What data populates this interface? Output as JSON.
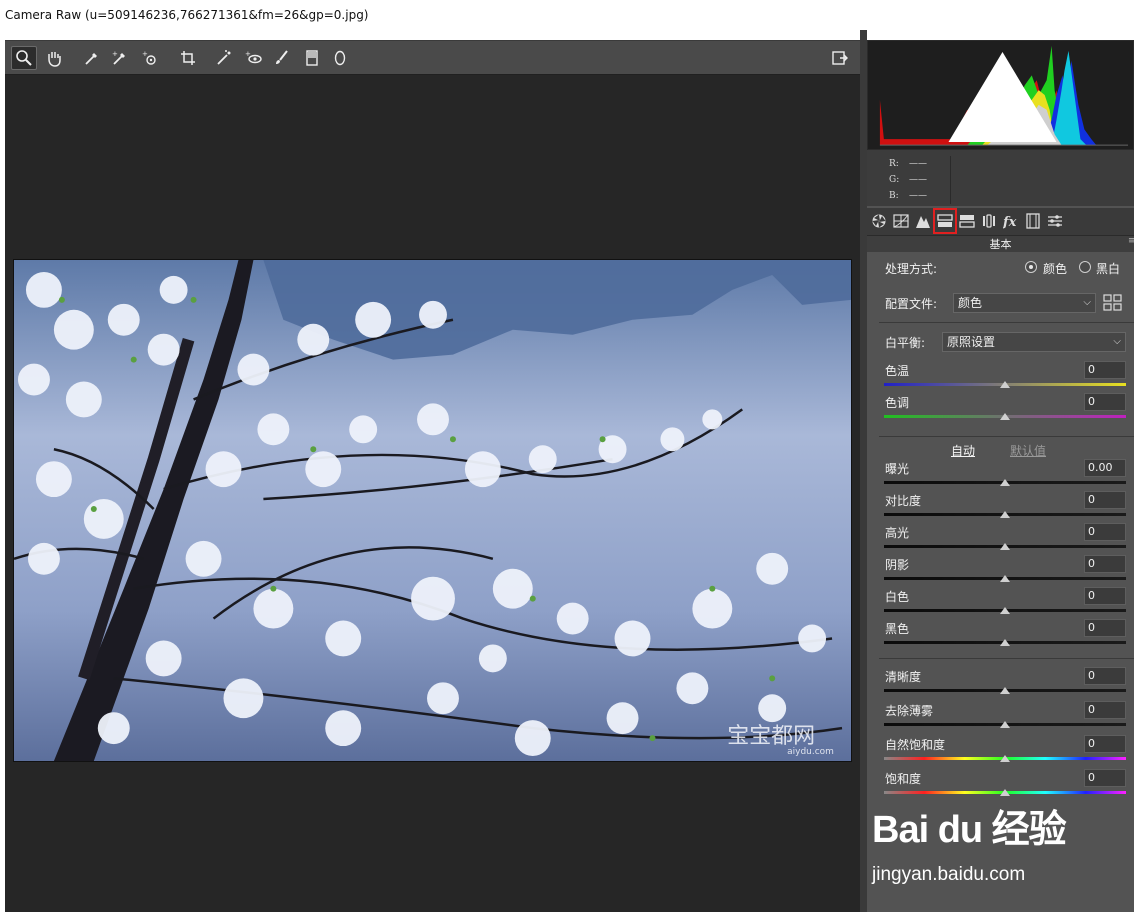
{
  "window": {
    "title": "Camera Raw (u=509146236,766271361&fm=26&gp=0.jpg)"
  },
  "toolbar": {
    "tools": [
      {
        "name": "zoom-icon",
        "active": true
      },
      {
        "name": "hand-icon"
      },
      {
        "name": "white-balance-icon"
      },
      {
        "name": "color-sampler-icon"
      },
      {
        "name": "targeted-adjustment-icon"
      },
      {
        "name": "crop-icon"
      },
      {
        "name": "straighten-icon"
      },
      {
        "name": "red-eye-icon"
      },
      {
        "name": "brush-icon"
      },
      {
        "name": "graduated-filter-icon"
      },
      {
        "name": "radial-filter-icon"
      }
    ],
    "fullscreen": "fullscreen-icon"
  },
  "histogram": {
    "rgb": {
      "r_label": "R:",
      "g_label": "G:",
      "b_label": "B:",
      "r": "——",
      "g": "——",
      "b": "——"
    }
  },
  "panel_tabs": [
    {
      "name": "basic-tab-icon"
    },
    {
      "name": "tone-curve-tab-icon"
    },
    {
      "name": "detail-tab-icon"
    },
    {
      "name": "hsl-tab-icon",
      "highlighted": true
    },
    {
      "name": "split-toning-tab-icon"
    },
    {
      "name": "lens-corrections-tab-icon"
    },
    {
      "name": "effects-tab-icon"
    },
    {
      "name": "camera-calibration-tab-icon"
    },
    {
      "name": "presets-tab-icon"
    }
  ],
  "basic": {
    "section_title": "基本",
    "treatment_label": "处理方式:",
    "treatment_color": "颜色",
    "treatment_bw": "黑白",
    "treatment_selected": "color",
    "profile_label": "配置文件:",
    "profile_value": "颜色",
    "wb_label": "白平衡:",
    "wb_value": "原照设置",
    "auto_label": "自动",
    "default_label": "默认值",
    "sliders": [
      {
        "label": "色温",
        "value": "0",
        "position": 0.5,
        "track": "temp"
      },
      {
        "label": "色调",
        "value": "0",
        "position": 0.5,
        "track": "tint"
      },
      {
        "label": "曝光",
        "value": "0.00",
        "position": 0.5,
        "track": "dark"
      },
      {
        "label": "对比度",
        "value": "0",
        "position": 0.5,
        "track": "dark"
      },
      {
        "label": "高光",
        "value": "0",
        "position": 0.5,
        "track": "dark"
      },
      {
        "label": "阴影",
        "value": "0",
        "position": 0.5,
        "track": "dark"
      },
      {
        "label": "白色",
        "value": "0",
        "position": 0.5,
        "track": "dark"
      },
      {
        "label": "黑色",
        "value": "0",
        "position": 0.5,
        "track": "dark"
      },
      {
        "label": "清晰度",
        "value": "0",
        "position": 0.5,
        "track": "dark"
      },
      {
        "label": "去除薄雾",
        "value": "0",
        "position": 0.5,
        "track": "dark"
      },
      {
        "label": "自然饱和度",
        "value": "0",
        "position": 0.5,
        "track": "rainbow"
      },
      {
        "label": "饱和度",
        "value": "0",
        "position": 0.5,
        "track": "rainbow"
      }
    ]
  },
  "photo_watermark": "宝宝都网",
  "photo_watermark_sub": "aiydu.com",
  "watermark": {
    "logo": "Bai du 经验",
    "sub": "jingyan.baidu.com"
  },
  "colors": {
    "highlight": "#e02020",
    "panel_bg": "#535353",
    "canvas_bg": "#262626"
  }
}
